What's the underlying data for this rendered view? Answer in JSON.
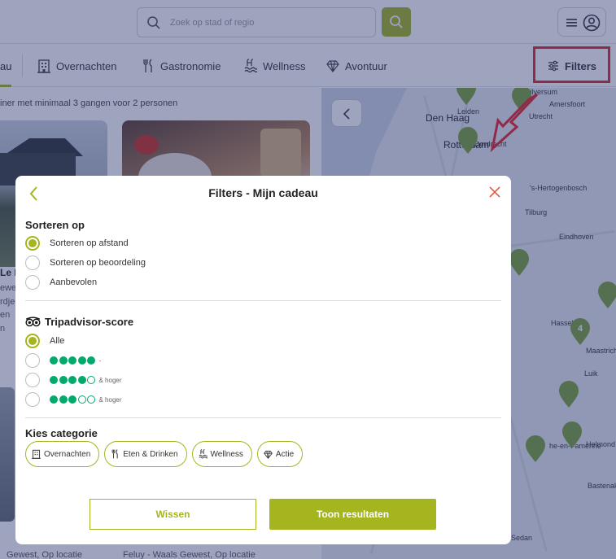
{
  "search": {
    "placeholder": "Zoek op stad of regio"
  },
  "categories": [
    {
      "label": "au",
      "icon": "gift-icon"
    },
    {
      "label": "Overnachten",
      "icon": "building-icon"
    },
    {
      "label": "Gastronomie",
      "icon": "fork-knife-icon"
    },
    {
      "label": "Wellness",
      "icon": "spa-icon"
    },
    {
      "label": "Avontuur",
      "icon": "diamond-icon"
    }
  ],
  "filters_button": {
    "label": "Filters",
    "icon": "sliders-icon"
  },
  "listing": {
    "subtitle": "iner met minimaal 3 gangen voor 2 personen",
    "card_left_lines": [
      "Le I",
      "ewe",
      "rdje",
      "en",
      "n"
    ],
    "bottom_left": "Gewest, Op locatie",
    "bottom_right": "Feluy - Waals Gewest, Op locatie"
  },
  "map": {
    "labels": [
      "Leiden",
      "Den Haag",
      "Rotterdam",
      "Dordrecht",
      "Utrecht",
      "Amersfoort",
      "Hilversum",
      "'s-Hertogenbosch",
      "Tilburg",
      "Eindhoven",
      "Hasselt",
      "Maastricht",
      "Luik",
      "Helmond",
      "Bastenak",
      "Sedan",
      "he-en-Famenne"
    ],
    "cluster_count": "4"
  },
  "modal": {
    "title": "Filters - Mijn cadeau",
    "sort": {
      "title": "Sorteren op",
      "options": [
        {
          "label": "Sorteren op afstand",
          "selected": true
        },
        {
          "label": "Sorteren op beoordeling",
          "selected": false
        },
        {
          "label": "Aanbevolen",
          "selected": false
        }
      ]
    },
    "tripadvisor": {
      "title": "Tripadvisor-score",
      "icon": "tripadvisor-owl-icon",
      "options": [
        {
          "label": "Alle",
          "selected": true
        },
        {
          "rating": 5,
          "suffix": "-",
          "selected": false
        },
        {
          "rating": 4,
          "suffix": "& hoger",
          "selected": false
        },
        {
          "rating": 3,
          "suffix": "& hoger",
          "selected": false
        }
      ]
    },
    "category": {
      "title": "Kies categorie",
      "chips": [
        {
          "label": "Overnachten",
          "icon": "building-icon"
        },
        {
          "label": "Eten & Drinken",
          "icon": "fork-knife-icon"
        },
        {
          "label": "Wellness",
          "icon": "spa-icon"
        },
        {
          "label": "Actie",
          "icon": "diamond-icon"
        }
      ]
    },
    "buttons": {
      "clear": "Wissen",
      "apply": "Toon resultaten"
    }
  },
  "colors": {
    "accent": "#a5b51f",
    "tripadvisor_green": "#00aa6c",
    "annotation_red": "#e8242a"
  }
}
